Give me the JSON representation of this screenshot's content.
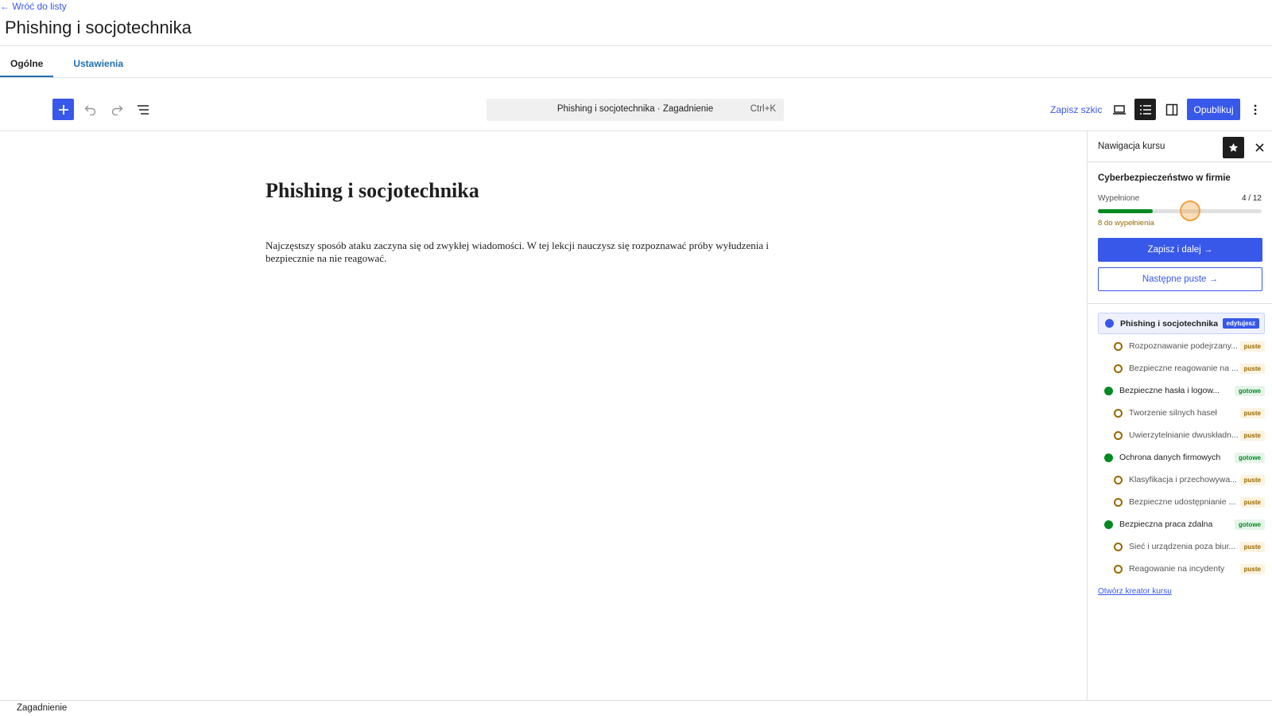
{
  "header": {
    "back_link": "← Wróć do listy",
    "title": "Phishing i socjotechnika"
  },
  "tabs": [
    {
      "label": "Ogólne",
      "active": true
    },
    {
      "label": "Ustawienia",
      "active": false
    }
  ],
  "toolbar": {
    "add_icon": "plus-icon",
    "undo_icon": "undo-icon",
    "redo_icon": "redo-icon",
    "outline_icon": "list-view-icon",
    "command_title": "Phishing i socjotechnika · Zagadnienie",
    "command_shortcut": "Ctrl+K",
    "save_draft": "Zapisz szkic",
    "publish": "Opublikuj"
  },
  "editor": {
    "post_title": "Phishing i socjotechnika",
    "post_body": "Najczęstszy sposób ataku zaczyna się od zwykłej wiadomości. W tej lekcji nauczysz się rozpoznawać próby wyłudzenia i bezpiecznie na nie reagować."
  },
  "sidebar": {
    "title": "Nawigacja kursu",
    "course_title": "Cyberbezpieczeństwo w firmie",
    "fill_label": "Wypełnione",
    "fill_count": "4 / 12",
    "progress_fraction": 0.333,
    "remaining": "8 do wypełnienia",
    "save_next": "Zapisz i dalej →",
    "next_empty": "Następne puste →",
    "open_builder": "Otwórz kreator kursu",
    "lessons": [
      {
        "label": "Phishing i socjotechnika",
        "badge": "edytujesz",
        "status": "current",
        "level": 1
      },
      {
        "label": "Rozpoznawanie podejrzany...",
        "badge": "puste",
        "status": "empty",
        "level": 2
      },
      {
        "label": "Bezpieczne reagowanie na ...",
        "badge": "puste",
        "status": "empty",
        "level": 2
      },
      {
        "label": "Bezpieczne hasła i logow...",
        "badge": "gotowe",
        "status": "done",
        "level": 1
      },
      {
        "label": "Tworzenie silnych haseł",
        "badge": "puste",
        "status": "empty",
        "level": 2
      },
      {
        "label": "Uwierzytelnianie dwuskładn...",
        "badge": "puste",
        "status": "empty",
        "level": 2
      },
      {
        "label": "Ochrona danych firmowych",
        "badge": "gotowe",
        "status": "done",
        "level": 1
      },
      {
        "label": "Klasyfikacja i przechowywa...",
        "badge": "puste",
        "status": "empty",
        "level": 2
      },
      {
        "label": "Bezpieczne udostępnianie ...",
        "badge": "puste",
        "status": "empty",
        "level": 2
      },
      {
        "label": "Bezpieczna praca zdalna",
        "badge": "gotowe",
        "status": "done",
        "level": 1
      },
      {
        "label": "Sieć i urządzenia poza biur...",
        "badge": "puste",
        "status": "empty",
        "level": 2
      },
      {
        "label": "Reagowanie na incydenty",
        "badge": "puste",
        "status": "empty",
        "level": 2
      }
    ]
  },
  "footer": {
    "label": "Zagadnienie"
  },
  "colors": {
    "accent": "#3858e9",
    "success": "#008a20",
    "warning": "#996800"
  }
}
